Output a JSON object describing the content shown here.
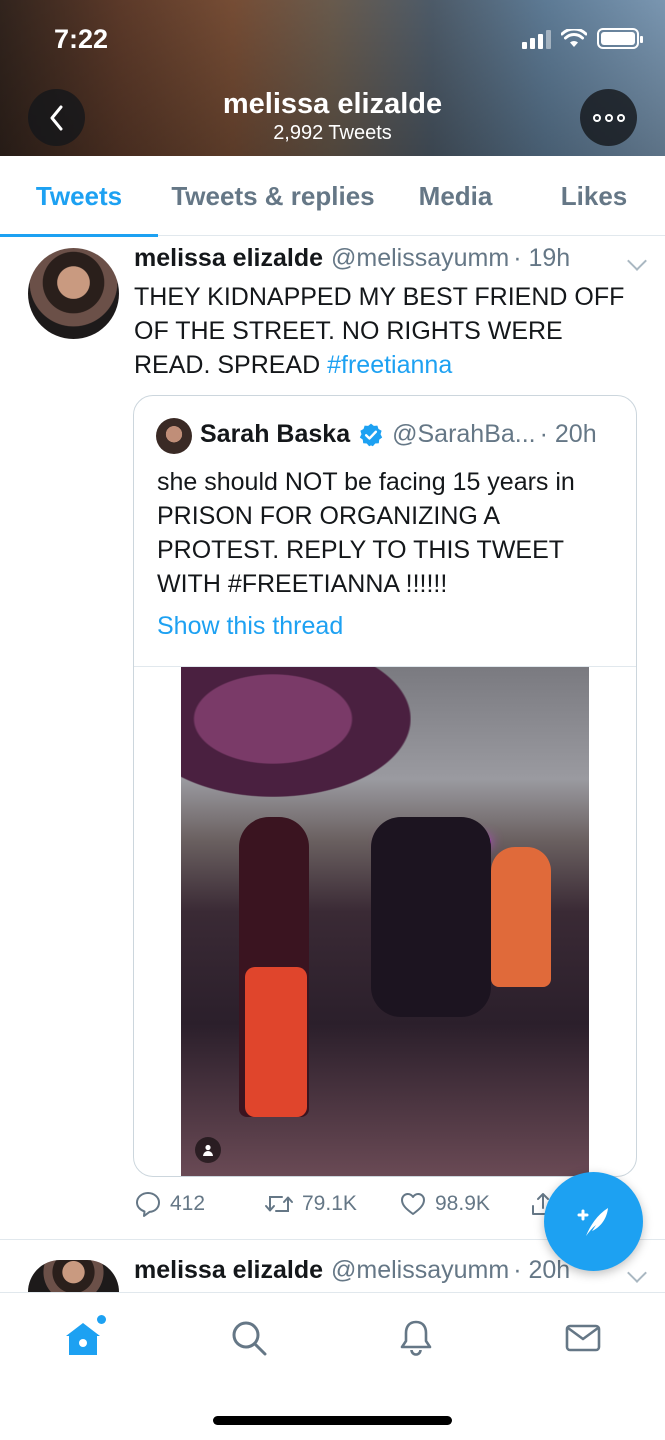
{
  "status_bar": {
    "time": "7:22"
  },
  "profile": {
    "name": "melissa elizalde",
    "tweet_count": "2,992 Tweets"
  },
  "header_icons": {
    "back": "chevron-left-icon",
    "more": "more-horizontal-icon"
  },
  "tabs": [
    {
      "label": "Tweets",
      "active": true
    },
    {
      "label": "Tweets & replies",
      "active": false
    },
    {
      "label": "Media",
      "active": false
    },
    {
      "label": "Likes",
      "active": false
    }
  ],
  "tweets": [
    {
      "author": "melissa elizalde",
      "handle": "@melissayumm",
      "time": "· 19h",
      "text": "THEY KIDNAPPED MY BEST FRIEND OFF OF THE STREET. NO RIGHTS WERE READ. SPREAD",
      "hashtag": "#freetianna",
      "quote": {
        "author": "Sarah Baska",
        "handle": "@SarahBa...",
        "time": "· 20h",
        "text": "she should NOT be facing 15 years in PRISON FOR ORGANIZING A PROTEST. REPLY TO THIS TWEET WITH #FREETIANNA !!!!!!",
        "show_thread": "Show this thread"
      },
      "stats": {
        "replies": "412",
        "retweets": "79.1K",
        "likes": "98.9K"
      }
    },
    {
      "author": "melissa elizalde",
      "handle": "@melissayumm",
      "time": "· 20h"
    }
  ],
  "colors": {
    "accent": "#1da1f2",
    "text": "#14171a",
    "secondary": "#657786",
    "border": "#e1e8ed"
  },
  "bottom_nav": [
    "home-icon",
    "search-icon",
    "notifications-icon",
    "messages-icon"
  ]
}
